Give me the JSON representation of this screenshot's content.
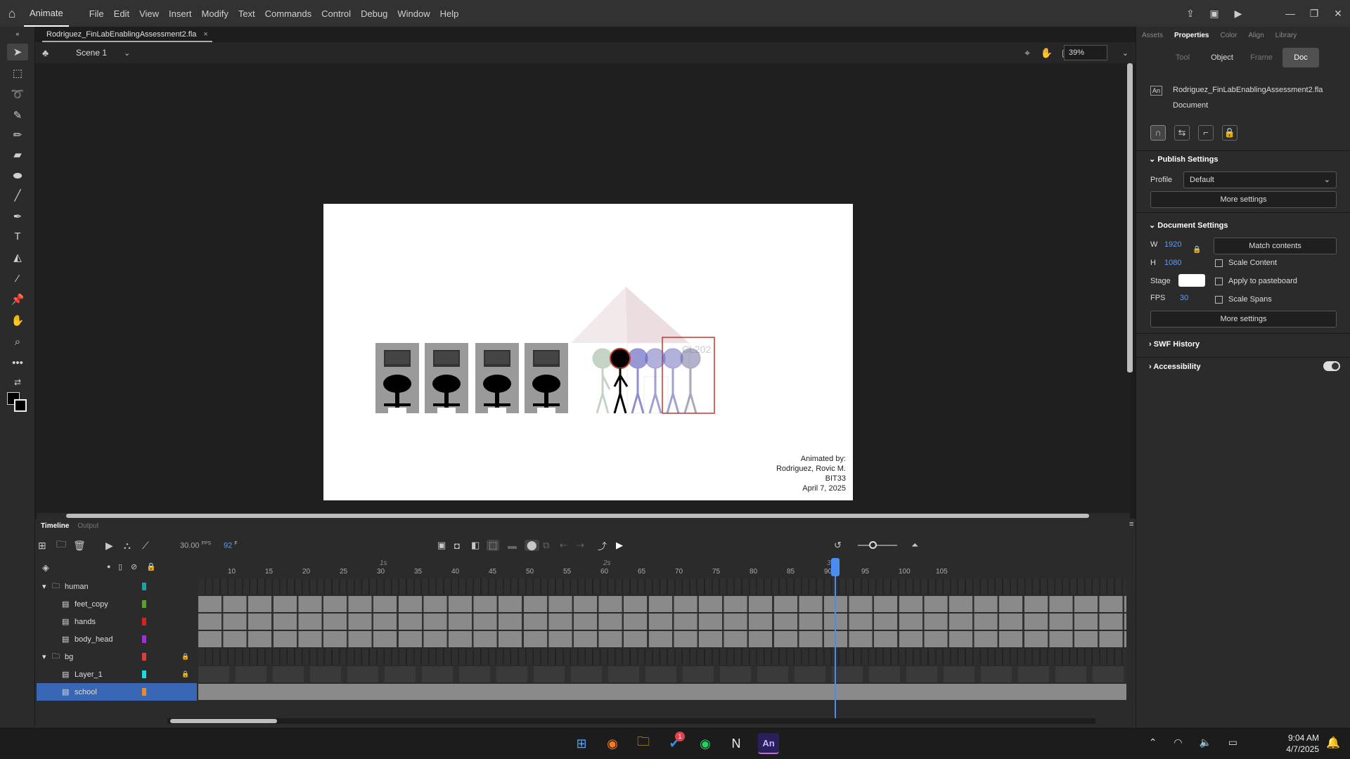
{
  "menubar": {
    "app_name": "Animate",
    "items": [
      "File",
      "Edit",
      "View",
      "Insert",
      "Modify",
      "Text",
      "Commands",
      "Control",
      "Debug",
      "Window",
      "Help"
    ]
  },
  "document": {
    "tab_title": "Rodriguez_FinLabEnablingAssessment2.fla"
  },
  "scene": {
    "name": "Scene 1",
    "zoom": "39%"
  },
  "stage": {
    "credits": [
      "Animated by:",
      "Rodriguez, Rovic M.",
      "BIT33",
      "April 7, 2025"
    ],
    "house_sign": "CL202"
  },
  "panel": {
    "tabs": [
      "Assets",
      "Properties",
      "Color",
      "Align",
      "Library"
    ],
    "active_tab": "Properties",
    "subtabs": [
      "Tool",
      "Object",
      "Frame",
      "Doc"
    ],
    "doc_name": "Rodriguez_FinLabEnablingAssessment2.fla",
    "doc_type": "Document",
    "publish": {
      "title": "Publish Settings",
      "profile_label": "Profile",
      "profile_value": "Default",
      "more": "More settings"
    },
    "docsettings": {
      "title": "Document Settings",
      "w_label": "W",
      "w": "1920",
      "h_label": "H",
      "h": "1080",
      "match": "Match contents",
      "scale_content": "Scale Content",
      "stage_label": "Stage",
      "apply_paste": "Apply to pasteboard",
      "fps_label": "FPS",
      "fps": "30",
      "scale_spans": "Scale Spans",
      "more": "More settings"
    },
    "swf_history": "SWF History",
    "accessibility": "Accessibility"
  },
  "timeline": {
    "tabs": [
      "Timeline",
      "Output"
    ],
    "fps": "30.00",
    "fps_unit": "FPS",
    "frame": "92",
    "frame_unit": "F",
    "ruler_labels": [
      "10",
      "15",
      "20",
      "25",
      "30",
      "35",
      "40",
      "45",
      "50",
      "55",
      "60",
      "65",
      "70",
      "75",
      "80",
      "85",
      "90",
      "95",
      "100",
      "105"
    ],
    "second_labels": [
      "1s",
      "2s",
      "3s"
    ],
    "layers": [
      {
        "name": "human",
        "folder": true,
        "indent": 0,
        "color": "#1aa3a3",
        "locked": false
      },
      {
        "name": "feet_copy",
        "folder": false,
        "indent": 1,
        "color": "#5aa02c",
        "locked": false
      },
      {
        "name": "hands",
        "folder": false,
        "indent": 1,
        "color": "#e01e1e",
        "locked": false
      },
      {
        "name": "body_head",
        "folder": false,
        "indent": 1,
        "color": "#9b30d9",
        "locked": false
      },
      {
        "name": "bg",
        "folder": true,
        "indent": 0,
        "color": "#e83a3a",
        "locked": true
      },
      {
        "name": "Layer_1",
        "folder": false,
        "indent": 1,
        "color": "#1fd8e0",
        "locked": true
      },
      {
        "name": "school",
        "folder": false,
        "indent": 1,
        "color": "#f08a1e",
        "locked": false,
        "selected": true
      }
    ]
  },
  "taskbar": {
    "time": "9:04 AM",
    "date": "4/7/2025",
    "notification_badge": "1"
  }
}
